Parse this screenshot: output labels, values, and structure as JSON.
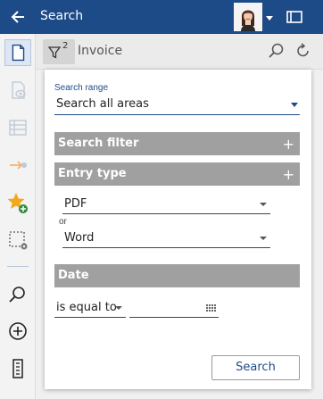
{
  "header": {
    "title": "Search",
    "back_icon": "arrow-left-icon",
    "window_icon": "window-icon"
  },
  "sidebar": {
    "items": [
      {
        "name": "document-icon"
      },
      {
        "name": "preview-icon"
      },
      {
        "name": "list-view-icon"
      },
      {
        "name": "forward-icon"
      },
      {
        "name": "add-favorite-icon"
      },
      {
        "name": "selection-settings-icon"
      },
      {
        "name": "search-icon"
      },
      {
        "name": "add-icon"
      },
      {
        "name": "document-info-icon"
      }
    ]
  },
  "searchbar": {
    "filter_count": "2",
    "query": "Invoice"
  },
  "panel": {
    "search_range_label": "Search range",
    "search_range_value": "Search all areas",
    "search_filter_title": "Search filter",
    "entry_type_title": "Entry type",
    "entry_type_value_1": "PDF",
    "or_label": "or",
    "entry_type_value_2": "Word",
    "date_title": "Date",
    "date_operator": "is equal to",
    "date_value": "",
    "plus": "+",
    "search_button": "Search"
  },
  "colors": {
    "brand": "#1d4b87",
    "section_bg": "#a0a0a0"
  }
}
